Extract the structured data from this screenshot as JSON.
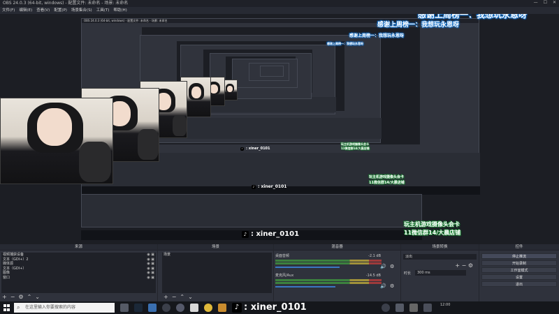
{
  "window": {
    "title": "OBS 24.0.3 (64-bit, windows) - 配置文件: 未命名 - 场景: 未命名",
    "controls": [
      "—",
      "☐",
      "✕"
    ]
  },
  "menu": [
    "文件(F)",
    "编辑(E)",
    "查看(V)",
    "配置(P)",
    "场景集合(S)",
    "工具(T)",
    "帮助(H)"
  ],
  "overlays": {
    "thanks_text": "感谢上周榜一：我想玩永恩呀",
    "promo_line1": "玩主机游戏摄像头会卡",
    "promo_line2": "11微信群14/大晨店铺",
    "nickname": ": xiner_0101"
  },
  "docks": {
    "sources": {
      "title": "来源",
      "items": [
        {
          "label": "视频捕获设备"
        },
        {
          "label": "文本（GDI+）2"
        },
        {
          "label": "媒体源"
        },
        {
          "label": "文本（GDI+）"
        },
        {
          "label": "图像"
        },
        {
          "label": "窗口"
        }
      ]
    },
    "scenes": {
      "title": "场景",
      "items": [
        {
          "label": "场景"
        }
      ]
    },
    "mixer": {
      "title": "混音器",
      "tracks": [
        {
          "name": "桌面音频",
          "db": "-2.1 dB",
          "level": 0.62
        },
        {
          "name": "麦克风/Aux",
          "db": "-14.5 dB",
          "level": 0.58
        }
      ]
    },
    "transitions": {
      "title": "场景转换",
      "selected": "淡出",
      "duration_label": "时长",
      "duration_value": "300 ms"
    },
    "controls": {
      "title": "控件",
      "buttons": [
        "停止推流",
        "开始录制",
        "工作室模式",
        "设置",
        "退出"
      ]
    }
  },
  "taskbar": {
    "search_placeholder": "在这里输入你要搜索的内容",
    "clock": "12:00"
  },
  "colors": {
    "overlay_glow": "#1477d6",
    "promo_glow": "#1c9c3a",
    "meter_green": "#3e8f3e",
    "accent_blue": "#3a78c2"
  }
}
